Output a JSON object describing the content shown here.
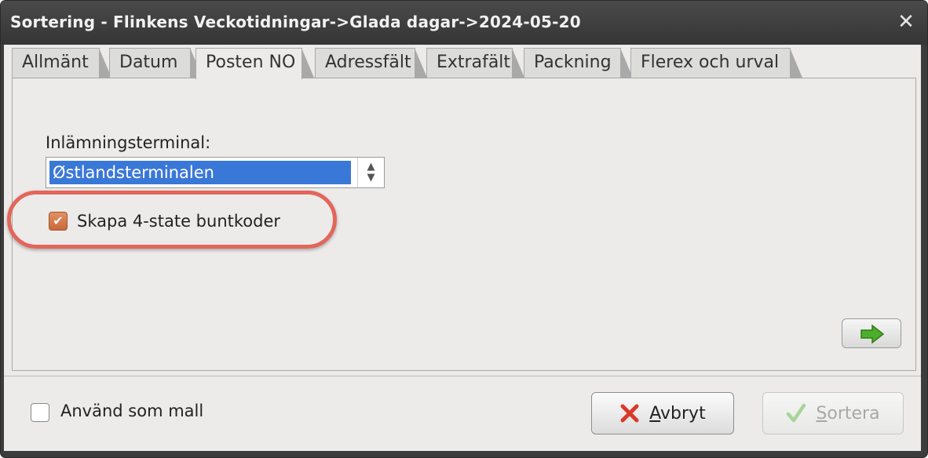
{
  "window": {
    "title": "Sortering - Flinkens Veckotidningar->Glada dagar->2024-05-20",
    "close_glyph": "✕"
  },
  "tabs": [
    {
      "label": "Allmänt"
    },
    {
      "label": "Datum"
    },
    {
      "label": "Posten NO",
      "active": true
    },
    {
      "label": "Adressfält"
    },
    {
      "label": "Extrafält"
    },
    {
      "label": "Packning"
    },
    {
      "label": "Flerex och urval"
    }
  ],
  "posten": {
    "terminal_label": "Inlämningsterminal:",
    "terminal_value": "Østlandsterminalen",
    "buntkoder_label": "Skapa 4-state buntkoder",
    "buntkoder_checked": true
  },
  "next_button": {
    "icon": "arrow-right-icon"
  },
  "footer": {
    "mall_label": "Använd som mall",
    "mall_checked": false,
    "cancel_label_first": "A",
    "cancel_label_rest": "vbryt",
    "sort_label_first": "S",
    "sort_label_rest": "ortera"
  },
  "colors": {
    "highlight": "#e3665b",
    "selection": "#3a78d8",
    "arrow_green": "#4cae2a",
    "cancel_red": "#d83a2a"
  }
}
